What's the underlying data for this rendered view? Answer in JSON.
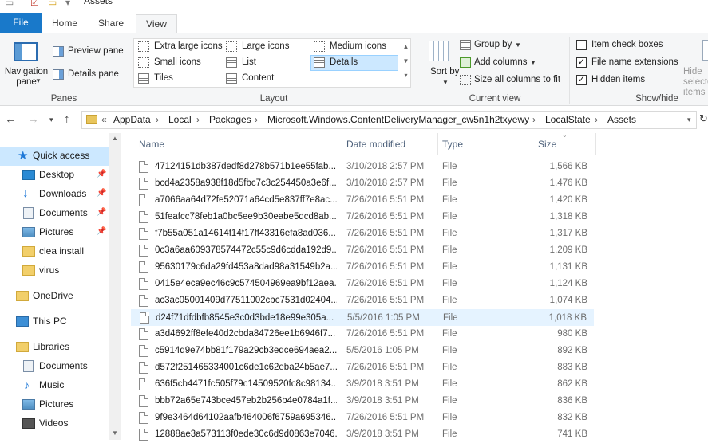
{
  "window": {
    "title": "Assets"
  },
  "tabs": [
    "File",
    "Home",
    "Share",
    "View"
  ],
  "ribbon": {
    "panes": {
      "navigation_pane": "Navigation pane",
      "preview_pane": "Preview pane",
      "details_pane": "Details pane",
      "label": "Panes"
    },
    "layout": {
      "items": [
        "Extra large icons",
        "Large icons",
        "Medium icons",
        "Small icons",
        "List",
        "Details",
        "Tiles",
        "Content"
      ],
      "selected": "Details",
      "label": "Layout"
    },
    "current_view": {
      "sort_by": "Sort by",
      "group_by": "Group by",
      "add_columns": "Add columns",
      "size_all": "Size all columns to fit",
      "label": "Current view"
    },
    "show_hide": {
      "item_check_boxes": {
        "label": "Item check boxes",
        "checked": false
      },
      "file_name_extensions": {
        "label": "File name extensions",
        "checked": true
      },
      "hidden_items": {
        "label": "Hidden items",
        "checked": true
      },
      "hide_selected": "Hide selected items",
      "label": "Show/hide"
    }
  },
  "address": {
    "breadcrumbs": [
      "AppData",
      "Local",
      "Packages",
      "Microsoft.Windows.ContentDeliveryManager_cw5n1h2txyewy",
      "LocalState",
      "Assets"
    ]
  },
  "nav": {
    "quick_access": "Quick access",
    "pinned": [
      "Desktop",
      "Downloads",
      "Documents",
      "Pictures"
    ],
    "folders": [
      "clea install",
      "virus"
    ],
    "onedrive": "OneDrive",
    "this_pc": "This PC",
    "libraries": "Libraries",
    "library_items": [
      "Documents",
      "Music",
      "Pictures",
      "Videos"
    ]
  },
  "columns": {
    "name": "Name",
    "date": "Date modified",
    "type": "Type",
    "size": "Size"
  },
  "files": [
    {
      "name": "47124151db387dedf8d278b571b1ee55fab...",
      "date": "3/10/2018 2:57 PM",
      "type": "File",
      "size": "1,566 KB"
    },
    {
      "name": "bcd4a2358a938f18d5fbc7c3c254450a3e6f...",
      "date": "3/10/2018 2:57 PM",
      "type": "File",
      "size": "1,476 KB"
    },
    {
      "name": "a7066aa64d72fe52071a64cd5e837ff7e8ac...",
      "date": "7/26/2016 5:51 PM",
      "type": "File",
      "size": "1,420 KB"
    },
    {
      "name": "51feafcc78feb1a0bc5ee9b30eabe5dcd8ab...",
      "date": "7/26/2016 5:51 PM",
      "type": "File",
      "size": "1,318 KB"
    },
    {
      "name": "f7b55a051a14614f14f17ff43316efa8ad036...",
      "date": "7/26/2016 5:51 PM",
      "type": "File",
      "size": "1,317 KB"
    },
    {
      "name": "0c3a6aa609378574472c55c9d6cdda192d9...",
      "date": "7/26/2016 5:51 PM",
      "type": "File",
      "size": "1,209 KB"
    },
    {
      "name": "95630179c6da29fd453a8dad98a31549b2a...",
      "date": "7/26/2016 5:51 PM",
      "type": "File",
      "size": "1,131 KB"
    },
    {
      "name": "0415e4eca9ec46c9c574504969ea9bf12aea...",
      "date": "7/26/2016 5:51 PM",
      "type": "File",
      "size": "1,124 KB"
    },
    {
      "name": "ac3ac05001409d77511002cbc7531d02404...",
      "date": "7/26/2016 5:51 PM",
      "type": "File",
      "size": "1,074 KB"
    },
    {
      "name": "d24f71dfdbfb8545e3c0d3bde18e99e305a...",
      "date": "5/5/2016 1:05 PM",
      "type": "File",
      "size": "1,018 KB",
      "selected": true
    },
    {
      "name": "a3d4692ff8efe40d2cbda84726ee1b6946f7...",
      "date": "7/26/2016 5:51 PM",
      "type": "File",
      "size": "980 KB"
    },
    {
      "name": "c5914d9e74bb81f179a29cb3edce694aea2...",
      "date": "5/5/2016 1:05 PM",
      "type": "File",
      "size": "892 KB"
    },
    {
      "name": "d572f251465334001c6de1c62eba24b5ae7...",
      "date": "7/26/2016 5:51 PM",
      "type": "File",
      "size": "883 KB"
    },
    {
      "name": "636f5cb4471fc505f79c14509520fc8c98134...",
      "date": "3/9/2018 3:51 PM",
      "type": "File",
      "size": "862 KB"
    },
    {
      "name": "bbb72a65e743bce457eb2b256b4e0784a1f...",
      "date": "3/9/2018 3:51 PM",
      "type": "File",
      "size": "836 KB"
    },
    {
      "name": "9f9e3464d64102aafb464006f6759a695346...",
      "date": "7/26/2016 5:51 PM",
      "type": "File",
      "size": "832 KB"
    },
    {
      "name": "12888ae3a573113f0ede30c6d9d0863e7046...",
      "date": "3/9/2018 3:51 PM",
      "type": "File",
      "size": "741 KB"
    }
  ]
}
